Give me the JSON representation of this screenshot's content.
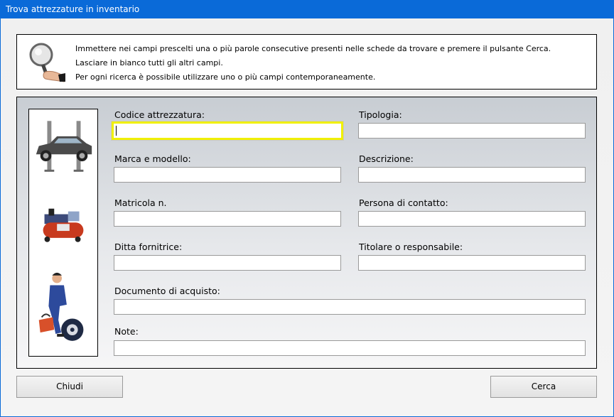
{
  "window": {
    "title": "Trova attrezzature in inventario"
  },
  "info": {
    "icon": "magnifier-hand-icon",
    "lines": [
      "Immettere nei campi prescelti una o più parole consecutive presenti nelle schede da trovare e premere il pulsante Cerca.",
      "Lasciare in bianco tutti gli altri campi.",
      "Per ogni ricerca è possibile utilizzare uno o più campi contemporaneamente."
    ]
  },
  "images": [
    "car-lift-icon",
    "air-compressor-icon",
    "mechanic-icon"
  ],
  "fields": {
    "codice": {
      "label": "Codice attrezzatura:",
      "value": ""
    },
    "tipologia": {
      "label": "Tipologia:",
      "value": ""
    },
    "marca": {
      "label": "Marca e modello:",
      "value": ""
    },
    "descrizione": {
      "label": "Descrizione:",
      "value": ""
    },
    "matricola": {
      "label": "Matricola n.",
      "value": ""
    },
    "persona": {
      "label": "Persona di contatto:",
      "value": ""
    },
    "ditta": {
      "label": "Ditta fornitrice:",
      "value": ""
    },
    "titolare": {
      "label": "Titolare o responsabile:",
      "value": ""
    },
    "documento": {
      "label": "Documento di acquisto:",
      "value": ""
    },
    "note": {
      "label": "Note:",
      "value": ""
    }
  },
  "buttons": {
    "close": "Chiudi",
    "search": "Cerca"
  }
}
